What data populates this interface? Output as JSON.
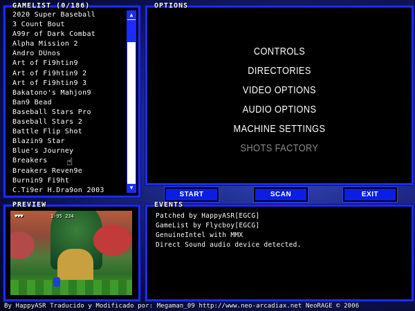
{
  "gamelist": {
    "title": "GAMELIST (0/186)",
    "items": [
      "2020 Super Baseball",
      "3 Count Bout",
      "A99r of Dark Combat",
      "Alpha Mission 2",
      "Andro DUnos",
      "Art of Fi9htin9",
      "Art of Fi9htin9 2",
      "Art of Fi9htin9 3",
      "Bakatono's Mahjon9",
      "Ban9 Bead",
      "Baseball Stars Pro",
      "Baseball Stars 2",
      "Battle Flip Shot",
      "Blazin9 Star",
      "Blue's Journey",
      "Breakers",
      "Breakers Reven9e",
      "Burnin9 Fi9ht",
      "C.Ti9er H.Dra9on 2003"
    ],
    "scroll_up_icon": "▲",
    "scroll_down_icon": "▼"
  },
  "options": {
    "title": "OPTIONS",
    "items": [
      "CONTROLS",
      "DIRECTORIES",
      "VIDEO OPTIONS",
      "AUDIO OPTIONS",
      "MACHINE SETTINGS",
      "SHOTS FACTORY"
    ]
  },
  "buttons": {
    "start": "START",
    "scan": "SCAN",
    "exit": "EXIT"
  },
  "preview": {
    "title": "PREVIEW",
    "hud_left": "♥♥♥",
    "hud_right": "1-95  234"
  },
  "events": {
    "title": "EVENTS",
    "lines": [
      "Patched by HappyASR[EGCG]",
      "GameList by Flycboy[EGCG]",
      "GenuineIntel with MMX",
      "Direct Sound audio device detected."
    ]
  },
  "footer": "By HappyASR  Traducido y Modificado por: Megaman_09  http://www.neo-arcadiax.net  NeoRAGE © 2006",
  "colors": {
    "accent": "#1a2cff",
    "panel_bg": "#000000",
    "disabled": "#8a8a8a"
  }
}
